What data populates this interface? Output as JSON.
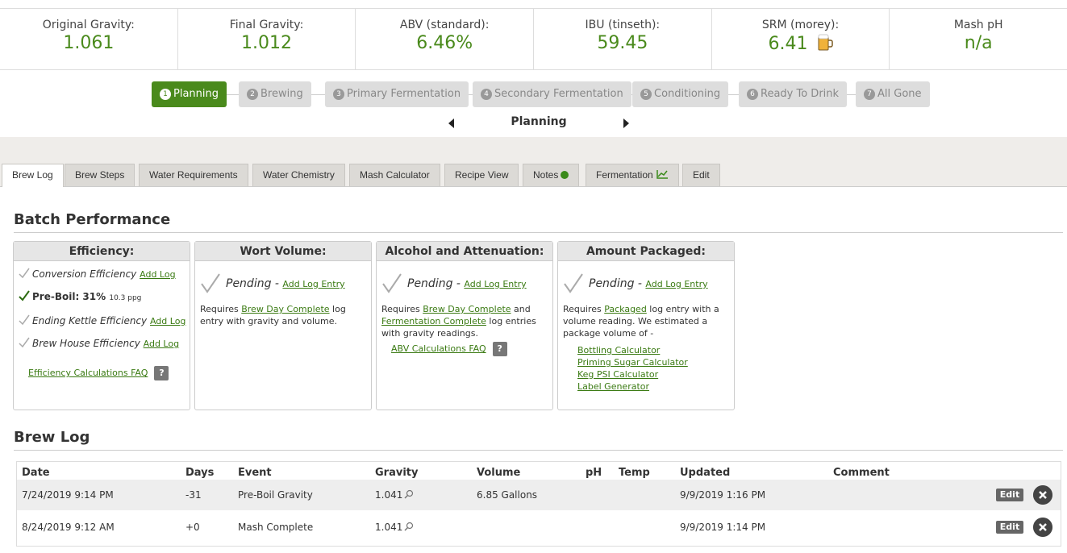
{
  "stats": [
    {
      "label": "Original Gravity:",
      "value": "1.061"
    },
    {
      "label": "Final Gravity:",
      "value": "1.012"
    },
    {
      "label": "ABV (standard):",
      "value": "6.46%"
    },
    {
      "label": "IBU (tinseth):",
      "value": "59.45"
    },
    {
      "label": "SRM (morey):",
      "value": "6.41"
    },
    {
      "label": "Mash pH",
      "value": "n/a"
    }
  ],
  "steps": [
    {
      "num": "1",
      "label": "Planning"
    },
    {
      "num": "2",
      "label": "Brewing"
    },
    {
      "num": "3",
      "label": "Primary Fermentation"
    },
    {
      "num": "4",
      "label": "Secondary Fermentation"
    },
    {
      "num": "5",
      "label": "Conditioning"
    },
    {
      "num": "6",
      "label": "Ready To Drink"
    },
    {
      "num": "7",
      "label": "All Gone"
    }
  ],
  "current_status": "Planning",
  "tabs": [
    "Brew Log",
    "Brew Steps",
    "Water Requirements",
    "Water Chemistry",
    "Mash Calculator",
    "Recipe View",
    "Notes",
    "Fermentation",
    "Edit"
  ],
  "batch_performance": {
    "title": "Batch Performance",
    "efficiency": {
      "title": "Efficiency:",
      "conversion_label": "Conversion Efficiency",
      "preboil_label": "Pre-Boil: 31%",
      "preboil_ppg": "10.3 ppg",
      "ending_label": "Ending Kettle Efficiency",
      "brewhouse_label": "Brew House Efficiency",
      "add_log": "Add Log",
      "faq": "Efficiency Calculations FAQ",
      "help": "?"
    },
    "wort": {
      "title": "Wort Volume:",
      "pending": "Pending -",
      "add_entry": "Add Log Entry",
      "req_prefix": "Requires",
      "req_link": "Brew Day Complete",
      "req_suffix": "log entry with gravity and volume."
    },
    "alcohol": {
      "title": "Alcohol and Attenuation:",
      "pending": "Pending -",
      "add_entry": "Add Log Entry",
      "req_prefix": "Requires",
      "req_link1": "Brew Day Complete",
      "req_mid": "and",
      "req_link2": "Fermentation Complete",
      "req_suffix": "log entries with gravity readings.",
      "faq": "ABV Calculations FAQ",
      "help": "?"
    },
    "packaged": {
      "title": "Amount Packaged:",
      "pending": "Pending -",
      "add_entry": "Add Log Entry",
      "req_prefix": "Requires",
      "req_link": "Packaged",
      "req_suffix": "log entry with a volume reading. We estimated a package volume of -",
      "links": [
        "Bottling Calculator",
        "Priming Sugar Calculator",
        "Keg PSI Calculator",
        "Label Generator"
      ]
    }
  },
  "brew_log": {
    "title": "Brew Log",
    "columns": [
      "Date",
      "Days",
      "Event",
      "Gravity",
      "Volume",
      "pH",
      "Temp",
      "Updated",
      "Comment"
    ],
    "rows": [
      {
        "date": "7/24/2019 9:14 PM",
        "days": "-31",
        "event": "Pre-Boil Gravity",
        "gravity": "1.041",
        "volume": "6.85 Gallons",
        "ph": "",
        "temp": "",
        "updated": "9/9/2019 1:16 PM",
        "comment": ""
      },
      {
        "date": "8/24/2019 9:12 AM",
        "days": "+0",
        "event": "Mash Complete",
        "gravity": "1.041",
        "volume": "",
        "ph": "",
        "temp": "",
        "updated": "9/9/2019 1:14 PM",
        "comment": ""
      }
    ],
    "edit_label": "Edit"
  },
  "colors": {
    "accent": "#4a8a1c",
    "link": "#3a7a12",
    "tab_bg": "#dcdad6"
  }
}
